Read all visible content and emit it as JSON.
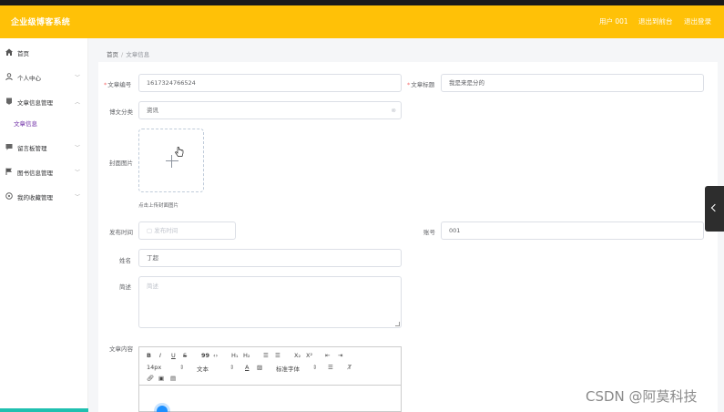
{
  "header": {
    "title": "企业级博客系统",
    "links": [
      "用户 001",
      "退出到前台",
      "退出登录"
    ]
  },
  "sidebar": {
    "items": [
      {
        "label": "首页",
        "icon": "home-icon"
      },
      {
        "label": "个人中心",
        "icon": "user-icon"
      },
      {
        "label": "文章信息管理",
        "icon": "article-icon",
        "expanded": true
      },
      {
        "label": "留言板管理",
        "icon": "message-icon"
      },
      {
        "label": "图书信息管理",
        "icon": "flag-icon"
      },
      {
        "label": "我的收藏管理",
        "icon": "star-icon"
      }
    ],
    "sub_item": "文章信息"
  },
  "breadcrumb": {
    "home": "首页",
    "current": "文章信息"
  },
  "form": {
    "article_no_label": "文章编号",
    "article_no_value": "1617324766524",
    "article_title_label": "文章标题",
    "article_title_value": "我是来是分的",
    "category_label": "博文分类",
    "category_value": "资讯",
    "cover_label": "封面图片",
    "cover_hint": "点击上传封面图片",
    "publish_time_label": "发布时间",
    "publish_time_placeholder": "发布时间",
    "account_label": "账号",
    "account_value": "001",
    "name_label": "姓名",
    "name_value": "丁超",
    "desc_label": "简述",
    "desc_placeholder": "简述",
    "content_label": "文章内容"
  },
  "editor": {
    "row1": [
      "B",
      "I",
      "U",
      "S",
      "99",
      "‹›",
      "H₁",
      "H₂",
      "☰",
      "☰",
      "X₂",
      "X²",
      "⇤",
      "⇥"
    ],
    "font_size": "14px",
    "text_style": "文本",
    "font_family": "标准字体"
  },
  "watermark": "CSDN @阿莫科技"
}
